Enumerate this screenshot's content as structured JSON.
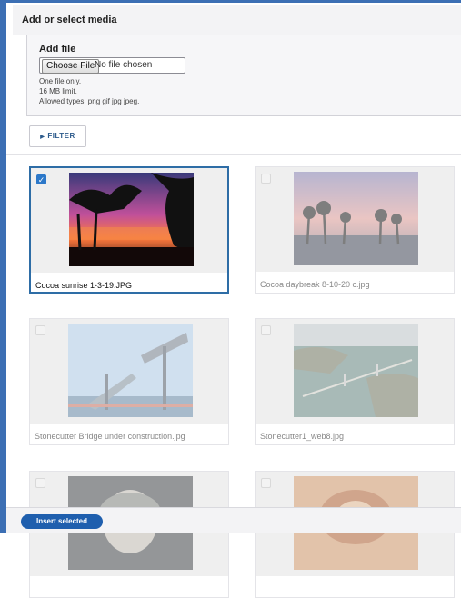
{
  "dialog": {
    "title": "Add or select media"
  },
  "add_file": {
    "label": "Add file",
    "choose_button": "Choose File",
    "file_status": "No file chosen",
    "hints": [
      "One file only.",
      "16 MB limit.",
      "Allowed types: png gif jpg jpeg."
    ]
  },
  "filter": {
    "label": "FILTER",
    "icon": "triangle-right-icon"
  },
  "media": [
    {
      "name": "Cocoa sunrise 1-3-19.JPG",
      "selected": true
    },
    {
      "name": "Cocoa daybreak 8-10-20 c.jpg",
      "selected": false
    },
    {
      "name": "Stonecutter Bridge under construction.jpg",
      "selected": false
    },
    {
      "name": "Stonecutter1_web8.jpg",
      "selected": false
    },
    {
      "name": "",
      "selected": false
    },
    {
      "name": "",
      "selected": false
    }
  ],
  "footer": {
    "insert_button": "Insert selected"
  },
  "colors": {
    "accent": "#2e6da6",
    "button": "#1f5fae"
  }
}
